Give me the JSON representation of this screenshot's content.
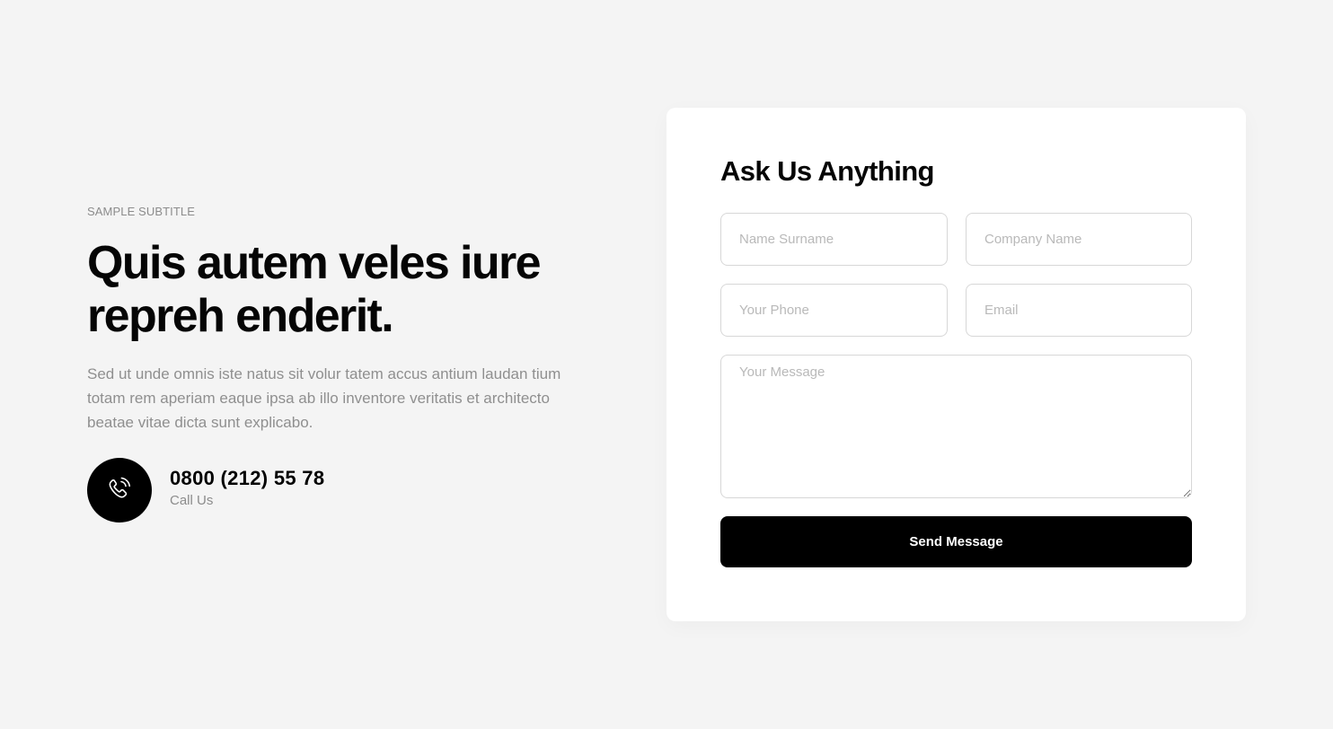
{
  "hero": {
    "subtitle": "SAMPLE SUBTITLE",
    "headline": "Quis autem veles iure repreh enderit.",
    "description": "Sed ut unde omnis iste natus sit volur tatem accus antium laudan tium totam rem aperiam eaque ipsa ab illo inventore veritatis et architecto beatae vitae dicta sunt explicabo.",
    "contact": {
      "icon": "phone-icon",
      "number": "0800 (212) 55 78",
      "label": "Call Us"
    }
  },
  "form": {
    "title": "Ask Us Anything",
    "fields": {
      "name": {
        "placeholder": "Name Surname",
        "value": ""
      },
      "company": {
        "placeholder": "Company Name",
        "value": ""
      },
      "phone": {
        "placeholder": "Your Phone",
        "value": ""
      },
      "email": {
        "placeholder": "Email",
        "value": ""
      },
      "message": {
        "placeholder": "Your Message",
        "value": ""
      }
    },
    "submit_label": "Send Message"
  },
  "colors": {
    "background": "#f4f4f4",
    "card": "#ffffff",
    "accent": "#000000",
    "muted_text": "#8f8f8f"
  }
}
